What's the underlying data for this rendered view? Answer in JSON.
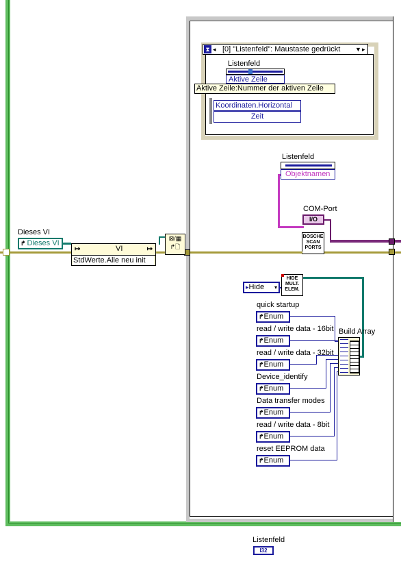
{
  "outer_loop": {
    "border_color": "#5fbd5f"
  },
  "event_structure": {
    "case_selector": "[0] \"Listenfeld\": Maustaste gedrückt",
    "node_label": "Listenfeld",
    "node_item_active_row": "Aktive Zeile",
    "tooltip": "Aktive Zeile:Nummer der aktiven Zeile",
    "coords_item_1": "Koordinaten.Horizontal",
    "coords_item_2": "Zeit"
  },
  "property_node_listenfeld": {
    "label": "Listenfeld",
    "item": "Objektnamen"
  },
  "com_port": {
    "label": "COM-Port",
    "terminal": "I/O"
  },
  "scan_ports_vi": {
    "text": "BOSCHE SCAN PORTS"
  },
  "dieses_vi": {
    "label": "Dieses VI",
    "constant": "Dieses VI"
  },
  "invoke_node": {
    "class": "VI",
    "method": "StdWerte.Alle neu init"
  },
  "hide_constant": "Hide",
  "hide_multi_vi": {
    "text": "HIDE MULT. ELEM."
  },
  "build_array": {
    "label": "Build Array"
  },
  "enum_constants": [
    {
      "label": "quick startup",
      "value": "Enum"
    },
    {
      "label": "read / write data - 16bit",
      "value": "Enum"
    },
    {
      "label": "read / write data - 32bit",
      "value": "Enum"
    },
    {
      "label": "Device_identify",
      "value": "Enum"
    },
    {
      "label": "Data transfer modes",
      "value": "Enum"
    },
    {
      "label": "read / write data - 8bit",
      "value": "Enum"
    },
    {
      "label": "reset EEPROM data",
      "value": "Enum"
    }
  ],
  "bottom_terminal": {
    "label": "Listenfeld",
    "terminal": "I32"
  },
  "colors": {
    "enum_blue": "#1a1a9c",
    "refnum_teal": "#127a6c",
    "error_wire_olive": "#a59a3a",
    "string_pink": "#c43ac0",
    "io_purple": "#6a1a6a"
  }
}
